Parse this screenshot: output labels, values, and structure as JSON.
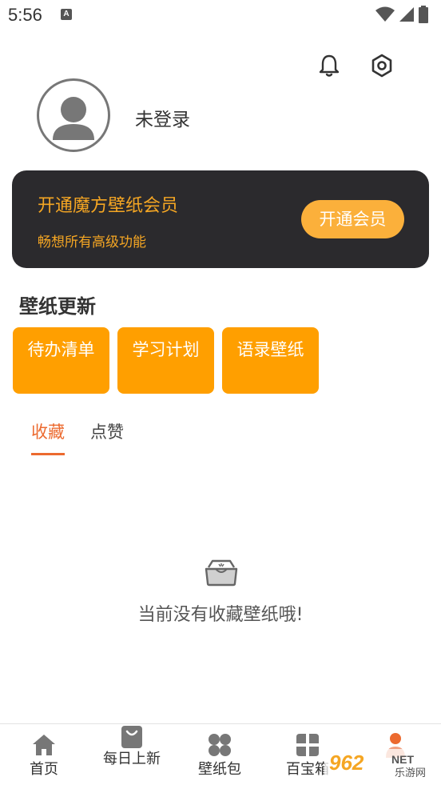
{
  "status_bar": {
    "time": "5:56",
    "notification_letter": "A"
  },
  "header": {
    "bell_icon": "bell-icon",
    "settings_icon": "settings-hexagon-icon"
  },
  "profile": {
    "login_status": "未登录"
  },
  "vip": {
    "title": "开通魔方壁纸会员",
    "subtitle": "畅想所有高级功能",
    "button_label": "开通会员"
  },
  "section": {
    "title": "壁纸更新"
  },
  "tiles": [
    {
      "label": "待办清单"
    },
    {
      "label": "学习计划"
    },
    {
      "label": "语录壁纸"
    }
  ],
  "tabs": [
    {
      "label": "收藏",
      "active": true
    },
    {
      "label": "点赞",
      "active": false
    }
  ],
  "empty": {
    "message": "当前没有收藏壁纸哦!"
  },
  "nav": [
    {
      "label": "首页",
      "icon": "home-icon"
    },
    {
      "label": "每日上新",
      "icon": "shopping-bag-icon"
    },
    {
      "label": "壁纸包",
      "icon": "grid-icon"
    },
    {
      "label": "百宝箱",
      "icon": "grid-icon"
    },
    {
      "label": "",
      "icon": "profile-dot-icon"
    }
  ],
  "watermark": {
    "text": "962",
    "suffix": "NET",
    "sub": "乐游网"
  },
  "colors": {
    "accent": "#ec6a2f",
    "tile": "#ff9f00",
    "vip_bg": "#2b2a2d",
    "vip_text": "#f5a623",
    "vip_button": "#fbb03b"
  }
}
